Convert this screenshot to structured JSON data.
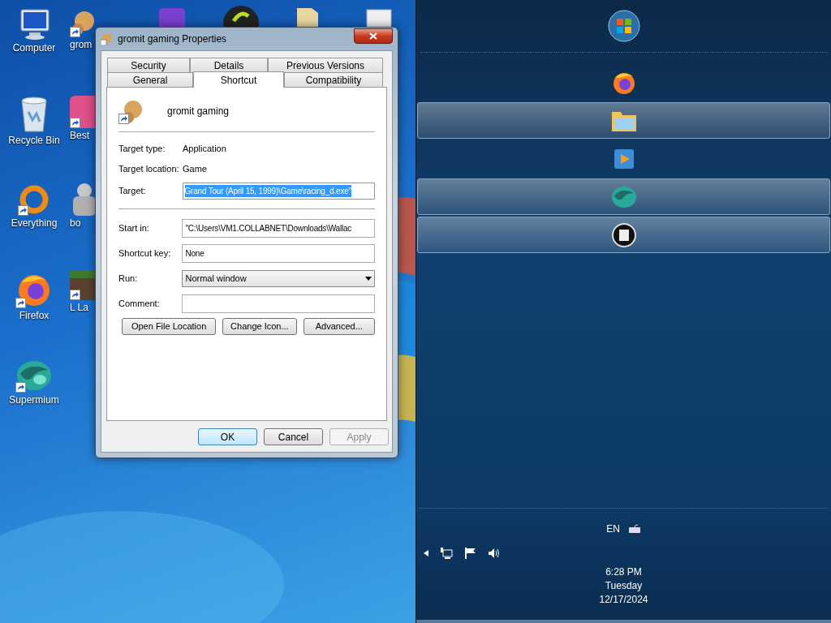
{
  "desktop": {
    "icons": [
      {
        "label": "Computer",
        "shortcut": false
      },
      {
        "label": "Recycle Bin",
        "shortcut": false
      },
      {
        "label": "Everything",
        "shortcut": true
      },
      {
        "label": "Firefox",
        "shortcut": true
      },
      {
        "label": "Supermium",
        "shortcut": true
      }
    ],
    "partial_icons": [
      {
        "label": "grom",
        "shortcut": true
      },
      {
        "label": "Best",
        "shortcut": true
      },
      {
        "label": "bo",
        "shortcut": false
      },
      {
        "label": "L La",
        "shortcut": true
      }
    ]
  },
  "dialog": {
    "title": "gromit gaming Properties",
    "tab_rows": [
      [
        {
          "label": "Security",
          "selected": false
        },
        {
          "label": "Details",
          "selected": false
        },
        {
          "label": "Previous Versions",
          "selected": false
        }
      ],
      [
        {
          "label": "General",
          "selected": false
        },
        {
          "label": "Shortcut",
          "selected": true
        },
        {
          "label": "Compatibility",
          "selected": false
        }
      ]
    ],
    "name": "gromit gaming",
    "info": [
      {
        "label": "Target type:",
        "value": "Application"
      },
      {
        "label": "Target location:",
        "value": "Game"
      }
    ],
    "target": {
      "label": "Target:",
      "value": "Grand Tour (April 15, 1999)\\Game\\racing_d.exe\"",
      "highlighted": true
    },
    "fields": [
      {
        "label": "Start in:",
        "kind": "text",
        "value": "\"C:\\Users\\VM1.COLLABNET\\Downloads\\Wallac"
      },
      {
        "label": "Shortcut key:",
        "kind": "text",
        "value": "None"
      },
      {
        "label": "Run:",
        "kind": "select",
        "value": "Normal window"
      },
      {
        "label": "Comment:",
        "kind": "text"
      }
    ],
    "actions": [
      "Open File Location",
      "Change Icon...",
      "Advanced..."
    ],
    "buttons": [
      {
        "label": "OK",
        "default": true,
        "disabled": false
      },
      {
        "label": "Cancel",
        "default": false,
        "disabled": false
      },
      {
        "label": "Apply",
        "default": false,
        "disabled": true
      }
    ]
  },
  "taskbar": {
    "items": [
      {
        "active": false
      },
      {
        "active": true
      },
      {
        "active": false
      },
      {
        "active": true
      },
      {
        "active": true
      }
    ],
    "language": "EN",
    "time": "6:28 PM",
    "day": "Tuesday",
    "date": "12/17/2024"
  }
}
